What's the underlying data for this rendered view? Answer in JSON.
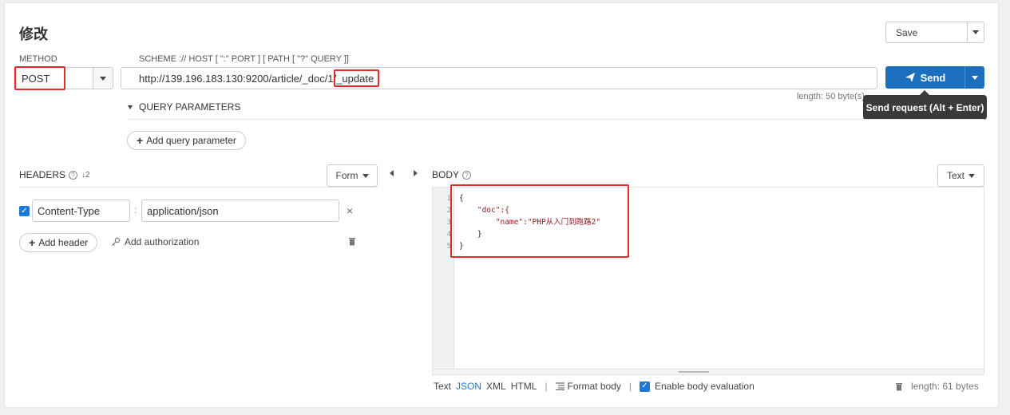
{
  "page_title": "修改",
  "save": {
    "label": "Save"
  },
  "method": {
    "label": "METHOD",
    "value": "POST"
  },
  "url": {
    "hint": "SCHEME :// HOST [ \":\" PORT ] [ PATH [ \"?\" QUERY ]]",
    "value_prefix": "http://139.196.183.130:9200/article/_doc/1/",
    "value_highlight": "_update",
    "length": "length: 50 byte(s)"
  },
  "send": {
    "label": "Send",
    "tooltip": "Send request (Alt + Enter)"
  },
  "query": {
    "label": "QUERY PARAMETERS",
    "add_label": "Add query parameter"
  },
  "headers": {
    "label": "HEADERS",
    "mode": "Form",
    "rows": [
      {
        "name": "Content-Type",
        "value": "application/json",
        "checked": true
      }
    ],
    "add_header": "Add header",
    "add_auth": "Add authorization"
  },
  "body": {
    "label": "BODY",
    "mode": "Text",
    "line_numbers": [
      "1",
      "2",
      "3",
      "4",
      "5"
    ],
    "lines": [
      "{",
      "    \"doc\":{",
      "        \"name\":\"PHP从入门到跑路2\"",
      "    }",
      "}"
    ],
    "formats": [
      "Text",
      "JSON",
      "XML",
      "HTML"
    ],
    "active_format": "JSON",
    "format_body": "Format body",
    "enable_eval": "Enable body evaluation",
    "length": "length: 61 bytes"
  },
  "colors": {
    "accent": "#1c6fbf",
    "highlight": "#e32b2b",
    "tooltip_bg": "#3a3a3a"
  }
}
